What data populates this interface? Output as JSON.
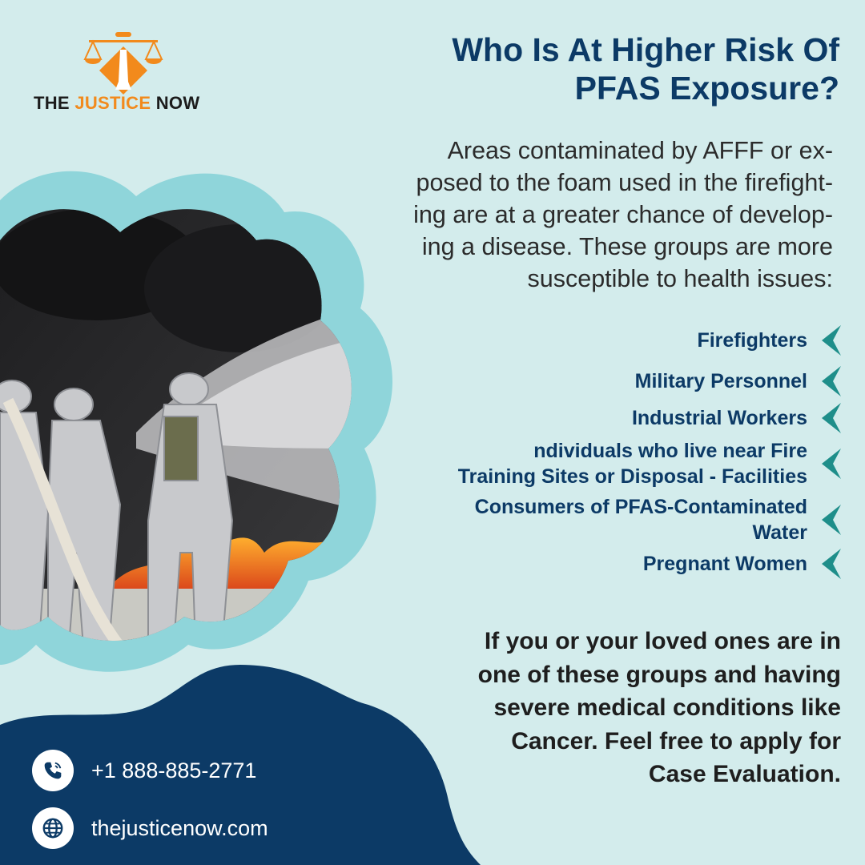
{
  "brand": {
    "name_part1": "THE ",
    "name_part2": "JUSTICE",
    "name_part3": " NOW",
    "logo_color": "#f28a1c"
  },
  "heading": {
    "line1": "Who Is At Higher Risk Of",
    "line2": "PFAS Exposure?"
  },
  "intro": {
    "lines": [
      "Areas contaminated by AFFF or ex-",
      "posed to the foam used in the firefight-",
      "ing are at a greater chance of develop-",
      "ing a disease. These groups are more",
      "susceptible to health issues:"
    ]
  },
  "risk_groups": [
    {
      "line1": "Firefighters",
      "line2": ""
    },
    {
      "line1": "Military Personnel",
      "line2": ""
    },
    {
      "line1": "Industrial Workers",
      "line2": ""
    },
    {
      "line1": "ndividuals who live near Fire",
      "line2": "Training Sites or Disposal - Facilities"
    },
    {
      "line1": "Consumers of PFAS-Contaminated",
      "line2": "Water"
    },
    {
      "line1": "Pregnant Women",
      "line2": ""
    }
  ],
  "cta": {
    "lines": [
      "If you or your loved ones are in",
      "one of these groups and having",
      "severe medical conditions like",
      "Cancer. Feel free to apply for",
      "Case Evaluation."
    ]
  },
  "contact": {
    "phone": "+1 888-885-2771",
    "website": "thejusticenow.com",
    "phone_icon": "phone-icon",
    "web_icon": "globe-icon"
  },
  "colors": {
    "background": "#d3ecec",
    "navy": "#0c3a66",
    "teal": "#8fd5da",
    "arrow": "#1e8e8a"
  }
}
